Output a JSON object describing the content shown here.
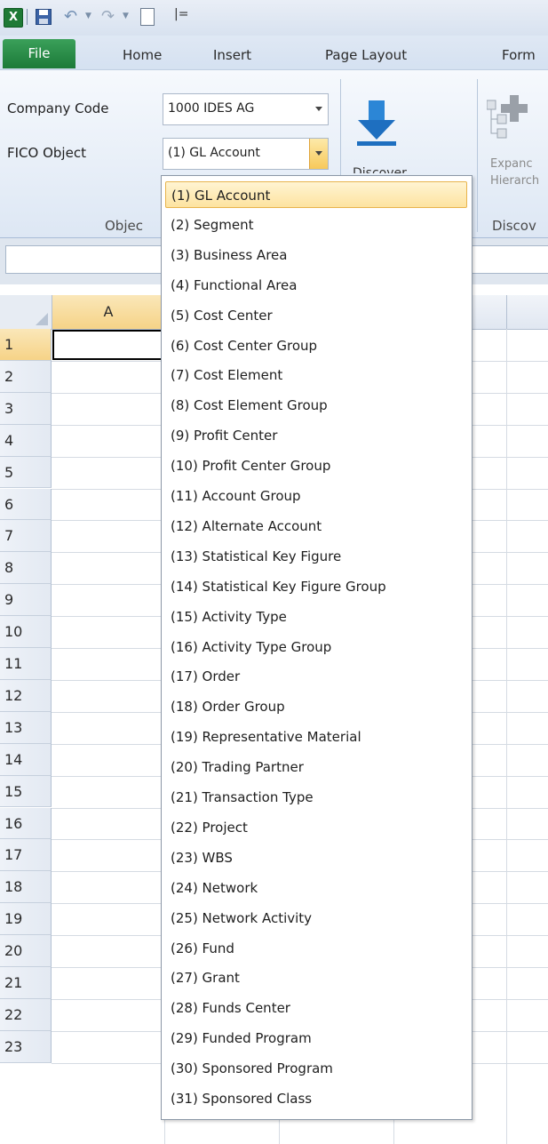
{
  "qat": {
    "logo": "X",
    "undo": "↶",
    "redo": "↷",
    "customize": "|="
  },
  "tabs": [
    "File",
    "Home",
    "Insert",
    "Page Layout",
    "Form"
  ],
  "ribbon": {
    "company_code_label": "Company Code",
    "company_code_value": "1000 IDES AG",
    "fico_object_label": "FICO Object",
    "fico_object_value": "(1) GL Account",
    "discover_label": "Discover",
    "expand_label_1": "Expanc",
    "expand_label_2": "Hierarch",
    "group_object": "Objec",
    "group_discover": "Discov"
  },
  "grid": {
    "columns": [
      "A"
    ],
    "rows": [
      "1",
      "2",
      "3",
      "4",
      "5",
      "6",
      "7",
      "8",
      "9",
      "10",
      "11",
      "12",
      "13",
      "14",
      "15",
      "16",
      "17",
      "18",
      "19",
      "20",
      "21",
      "22",
      "23"
    ]
  },
  "dropdown": {
    "selected_index": 0,
    "options": [
      "(1) GL Account",
      "(2) Segment",
      "(3) Business Area",
      "(4) Functional Area",
      "(5) Cost Center",
      "(6) Cost Center Group",
      "(7) Cost Element",
      "(8) Cost Element Group",
      "(9) Profit Center",
      "(10) Profit Center Group",
      "(11) Account Group",
      "(12) Alternate Account",
      "(13) Statistical Key Figure",
      "(14) Statistical Key Figure Group",
      "(15) Activity Type",
      "(16) Activity Type Group",
      "(17) Order",
      "(18) Order Group",
      "(19) Representative Material",
      "(20) Trading Partner",
      "(21) Transaction Type",
      "(22) Project",
      "(23) WBS",
      "(24) Network",
      "(25) Network Activity",
      "(26) Fund",
      "(27) Grant",
      "(28) Funds Center",
      "(29) Funded Program",
      "(30) Sponsored Program",
      "(31) Sponsored Class"
    ]
  }
}
